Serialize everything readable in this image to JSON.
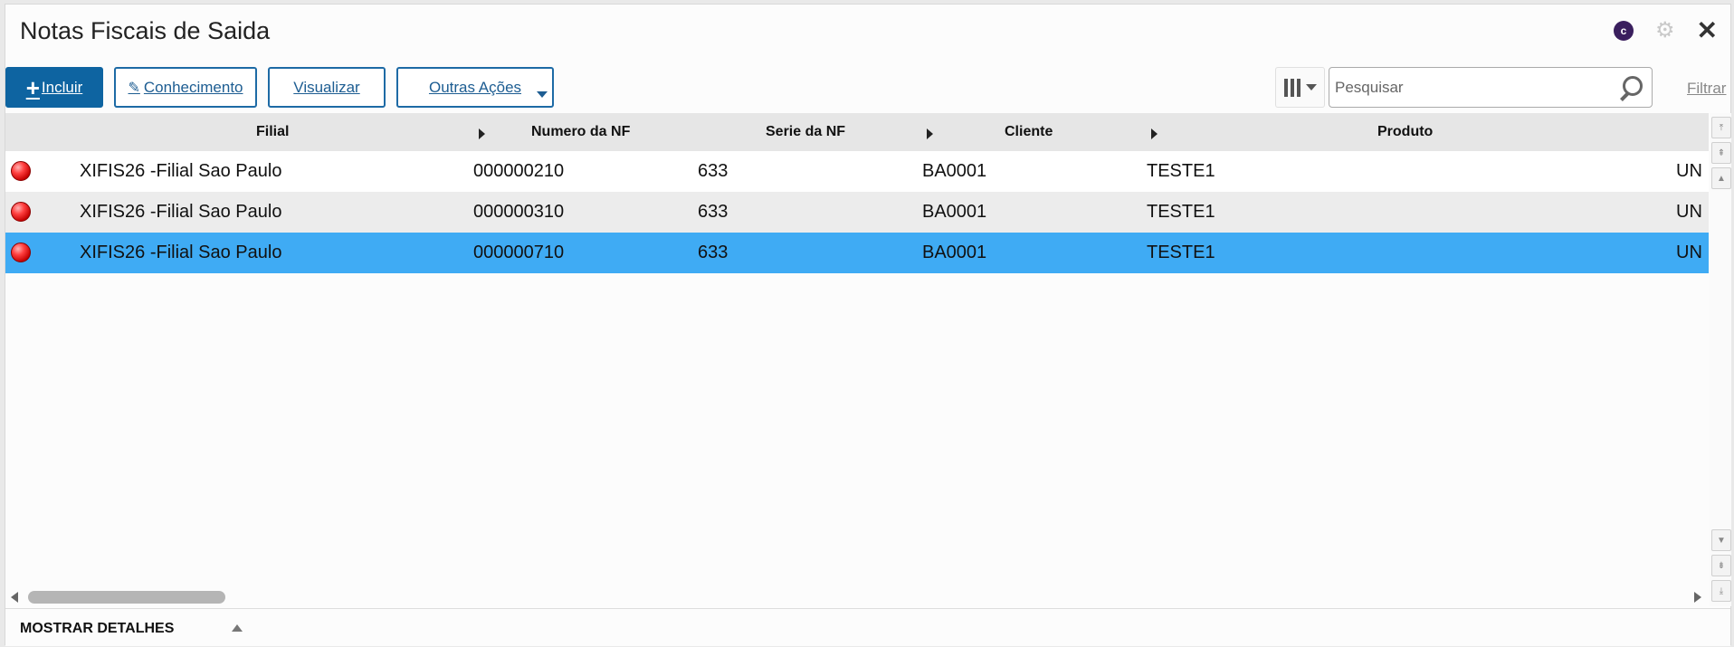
{
  "window": {
    "title": "Notas Fiscais de Saida"
  },
  "toolbar": {
    "incluir_label": "Incluir",
    "conhecimento_label": "Conhecimento",
    "visualizar_label": "Visualizar",
    "outras_label": "Outras Ações",
    "filtrar_label": "Filtrar"
  },
  "search": {
    "placeholder": "Pesquisar",
    "value": ""
  },
  "grid": {
    "headers": {
      "filial": "Filial",
      "numero": "Numero da NF",
      "serie": "Serie da NF",
      "cliente": "Cliente",
      "produto": "Produto"
    },
    "rows": [
      {
        "status": "red",
        "filial": "XIFIS26 -Filial Sao Paulo",
        "numero": "000000210",
        "serie": "633",
        "cliente": "BA0001",
        "produto": "TESTE1",
        "un": "UN"
      },
      {
        "status": "red",
        "filial": "XIFIS26 -Filial Sao Paulo",
        "numero": "000000310",
        "serie": "633",
        "cliente": "BA0001",
        "produto": "TESTE1",
        "un": "UN"
      },
      {
        "status": "red",
        "filial": "XIFIS26 -Filial Sao Paulo",
        "numero": "000000710",
        "serie": "633",
        "cliente": "BA0001",
        "produto": "TESTE1",
        "un": "UN"
      }
    ],
    "selected_row": 2
  },
  "footer": {
    "details_label": "MOSTRAR DETALHES"
  },
  "icons": {
    "header_badge": "c-circle-icon",
    "settings": "gear-icon",
    "close": "close-icon",
    "columns": "columns-icon",
    "search": "search-icon",
    "status": "red-status-icon"
  },
  "colors": {
    "primary": "#0e64a1",
    "selected_row": "#3fabf4",
    "status_red": "#ff4040"
  }
}
